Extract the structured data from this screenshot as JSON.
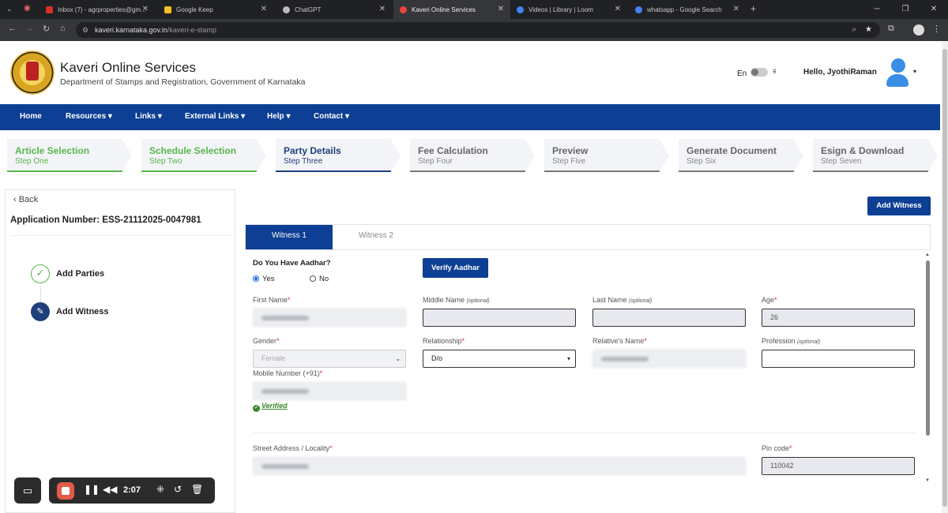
{
  "browser": {
    "tabs": [
      {
        "title": "Inbox (7) - agrproperties@gm...",
        "color": "#d93025"
      },
      {
        "title": "Google Keep",
        "color": "#f6bf26"
      },
      {
        "title": "ChatGPT",
        "color": "#bbbbbb"
      },
      {
        "title": "Kaveri Online Services",
        "color": "#e8453c"
      },
      {
        "title": "Videos | Library | Loom",
        "color": "#4285f4"
      },
      {
        "title": "whatsapp - Google Search",
        "color": "#4285f4"
      }
    ],
    "url_host": "kaveri.karnataka.gov.in",
    "url_path": "/kaveri-e-stamp"
  },
  "header": {
    "title": "Kaveri Online Services",
    "subtitle": "Department of Stamps and Registration, Government of Karnataka",
    "lang_en": "En",
    "lang_kn": "ಕ",
    "greeting": "Hello, JyothiRaman"
  },
  "nav": [
    "Home",
    "Resources ▾",
    "Links ▾",
    "External Links ▾",
    "Help ▾",
    "Contact ▾"
  ],
  "steps": [
    {
      "title": "Article Selection",
      "sub": "Step One",
      "state": "done"
    },
    {
      "title": "Schedule Selection",
      "sub": "Step Two",
      "state": "done"
    },
    {
      "title": "Party Details",
      "sub": "Step Three",
      "state": "cur"
    },
    {
      "title": "Fee Calculation",
      "sub": "Step Four",
      "state": "todo"
    },
    {
      "title": "Preview",
      "sub": "Step Five",
      "state": "todo"
    },
    {
      "title": "Generate Document",
      "sub": "Step Six",
      "state": "todo"
    },
    {
      "title": "Esign & Download",
      "sub": "Step Seven",
      "state": "todo"
    }
  ],
  "left": {
    "back": "Back",
    "application_number": "Application Number: ESS-21112025-0047981",
    "add_parties": "Add Parties",
    "add_witness": "Add Witness"
  },
  "right": {
    "add_witness_btn": "Add Witness",
    "tabs": [
      "Witness 1",
      "Witness 2"
    ],
    "aadhar_q": "Do You Have Aadhar?",
    "yes": "Yes",
    "no": "No",
    "verify_btn": "Verify Aadhar",
    "labels": {
      "first_name": "First Name",
      "middle_name": "Middle Name",
      "last_name": "Last Name",
      "age": "Age",
      "gender": "Gender",
      "relationship": "Relationship",
      "relatives_name": "Relative's Name",
      "profession": "Profession",
      "mobile": "Mobile Number (+91)",
      "street": "Street Address / Locality",
      "pincode": "Pin code",
      "optional": "(optional)",
      "req": "*"
    },
    "values": {
      "age": "26",
      "gender": "Female",
      "relationship": "D/o",
      "pincode": "110042"
    },
    "verified": "Verified"
  },
  "recorder": {
    "time": "2:07"
  }
}
